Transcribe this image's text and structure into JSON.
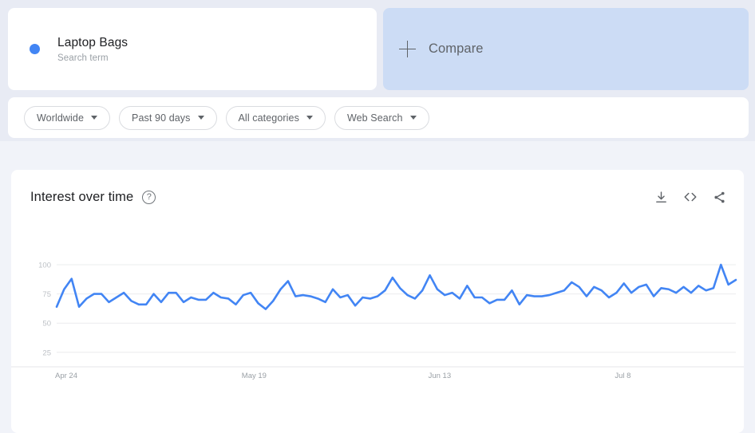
{
  "terms": [
    {
      "name": "Laptop Bags",
      "subtitle": "Search term",
      "color": "#4285f4"
    }
  ],
  "compare": {
    "label": "Compare",
    "icon": "plus-icon"
  },
  "filters": [
    {
      "label": "Worldwide",
      "icon": "chevron-down-icon"
    },
    {
      "label": "Past 90 days",
      "icon": "chevron-down-icon"
    },
    {
      "label": "All categories",
      "icon": "chevron-down-icon"
    },
    {
      "label": "Web Search",
      "icon": "chevron-down-icon"
    }
  ],
  "chart_card": {
    "title": "Interest over time",
    "help_icon": "question-mark-icon",
    "actions": [
      {
        "name": "download-icon",
        "tooltip": "Download"
      },
      {
        "name": "embed-code-icon",
        "tooltip": "Embed"
      },
      {
        "name": "share-icon",
        "tooltip": "Share"
      }
    ]
  },
  "chart_data": {
    "type": "line",
    "title": "Interest over time",
    "xlabel": "",
    "ylabel": "",
    "ylim": [
      0,
      105
    ],
    "yticks": [
      100,
      75,
      50,
      25
    ],
    "grid": true,
    "legend": "none",
    "line_color": "#4285f4",
    "xticks": [
      {
        "label": "Apr 24",
        "index": 0
      },
      {
        "label": "May 19",
        "index": 25
      },
      {
        "label": "Jun 13",
        "index": 50
      },
      {
        "label": "Jul 8",
        "index": 75
      }
    ],
    "x": [
      "Apr 24",
      "Apr 25",
      "Apr 26",
      "Apr 27",
      "Apr 28",
      "Apr 29",
      "Apr 30",
      "May 1",
      "May 2",
      "May 3",
      "May 4",
      "May 5",
      "May 6",
      "May 7",
      "May 8",
      "May 9",
      "May 10",
      "May 11",
      "May 12",
      "May 13",
      "May 14",
      "May 15",
      "May 16",
      "May 17",
      "May 18",
      "May 19",
      "May 20",
      "May 21",
      "May 22",
      "May 23",
      "May 24",
      "May 25",
      "May 26",
      "May 27",
      "May 28",
      "May 29",
      "May 30",
      "May 31",
      "Jun 1",
      "Jun 2",
      "Jun 3",
      "Jun 4",
      "Jun 5",
      "Jun 6",
      "Jun 7",
      "Jun 8",
      "Jun 9",
      "Jun 10",
      "Jun 11",
      "Jun 12",
      "Jun 13",
      "Jun 14",
      "Jun 15",
      "Jun 16",
      "Jun 17",
      "Jun 18",
      "Jun 19",
      "Jun 20",
      "Jun 21",
      "Jun 22",
      "Jun 23",
      "Jun 24",
      "Jun 25",
      "Jun 26",
      "Jun 27",
      "Jun 28",
      "Jun 29",
      "Jun 30",
      "Jul 1",
      "Jul 2",
      "Jul 3",
      "Jul 4",
      "Jul 5",
      "Jul 6",
      "Jul 7",
      "Jul 8",
      "Jul 9",
      "Jul 10",
      "Jul 11",
      "Jul 12",
      "Jul 13",
      "Jul 14",
      "Jul 15",
      "Jul 16",
      "Jul 17",
      "Jul 18",
      "Jul 19",
      "Jul 20",
      "Jul 21",
      "Jul 22"
    ],
    "series": [
      {
        "name": "Laptop Bags",
        "color": "#4285f4",
        "values": [
          64,
          79,
          88,
          64,
          71,
          75,
          75,
          68,
          72,
          76,
          69,
          66,
          66,
          75,
          68,
          76,
          76,
          68,
          72,
          70,
          70,
          76,
          72,
          71,
          66,
          74,
          76,
          67,
          62,
          69,
          79,
          86,
          73,
          74,
          73,
          71,
          68,
          79,
          72,
          74,
          65,
          72,
          71,
          73,
          78,
          89,
          80,
          74,
          71,
          78,
          91,
          79,
          74,
          76,
          71,
          82,
          72,
          72,
          67,
          70,
          70,
          78,
          66,
          74,
          73,
          73,
          74,
          76,
          78,
          85,
          81,
          73,
          81,
          78,
          72,
          76,
          84,
          76,
          81,
          83,
          73,
          80,
          79,
          76,
          81,
          76,
          82,
          78,
          80,
          100,
          83,
          87
        ]
      }
    ]
  }
}
